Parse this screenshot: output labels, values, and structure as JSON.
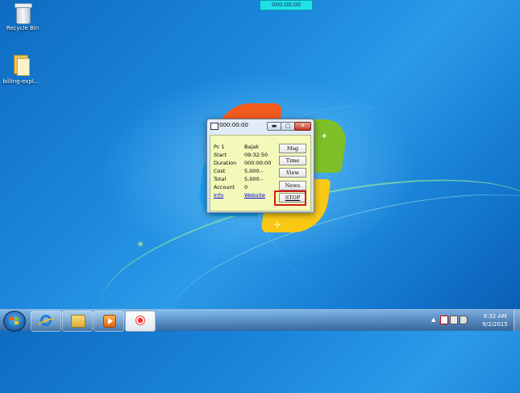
{
  "top_timer": {
    "text": "000:00:00",
    "color": "#22e0e8"
  },
  "desktop": {
    "icons": [
      {
        "label": "Recycle Bin",
        "icon": "recycle-bin-icon"
      },
      {
        "label": "billing-expl...",
        "icon": "folder-icon"
      }
    ]
  },
  "billing_window": {
    "title": "000:00:00",
    "rows": [
      {
        "label": "Pc 1",
        "value": "Bajak"
      },
      {
        "label": "Start",
        "value": "09:32:50"
      },
      {
        "label": "Duration",
        "value": "000:00:00"
      },
      {
        "label": "Cost",
        "value": "5,000.-"
      },
      {
        "label": "Total",
        "value": "5,000.-"
      },
      {
        "label": "Account",
        "value": "0"
      }
    ],
    "links": {
      "info": "Info",
      "website": "Website"
    },
    "buttons": {
      "msg": "Msg",
      "time": "Time",
      "view": "View",
      "news": "News",
      "stop": "STOP"
    },
    "panel_color": "#f3f9b9",
    "highlight_color": "#d11a1a"
  },
  "taskbar": {
    "apps": [
      "internet-explorer-icon",
      "windows-explorer-icon",
      "media-player-icon",
      "record-app-icon"
    ],
    "tray": {
      "arrow": "▲"
    },
    "clock": {
      "time": "9:32 AM",
      "date": "9/2/2015"
    }
  }
}
